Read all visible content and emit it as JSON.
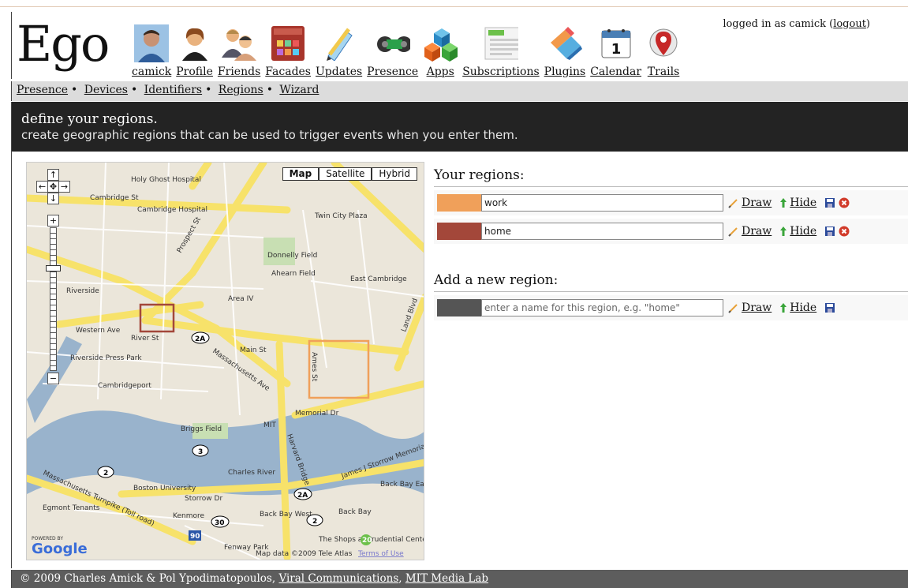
{
  "app": {
    "logo": "Ego"
  },
  "login": {
    "prefix": "logged in as camick (",
    "logout": "logout",
    "suffix": ")"
  },
  "nav": [
    {
      "label": "camick",
      "icon": "user-avatar-icon"
    },
    {
      "label": "Profile",
      "icon": "profile-icon"
    },
    {
      "label": "Friends",
      "icon": "friends-icon"
    },
    {
      "label": "Facades",
      "icon": "facades-icon"
    },
    {
      "label": "Updates",
      "icon": "pencil-icon"
    },
    {
      "label": "Presence",
      "icon": "presence-icon"
    },
    {
      "label": "Apps",
      "icon": "cubes-icon"
    },
    {
      "label": "Subscriptions",
      "icon": "subscriptions-icon"
    },
    {
      "label": "Plugins",
      "icon": "plugins-icon"
    },
    {
      "label": "Calendar",
      "icon": "calendar-icon"
    },
    {
      "label": "Trails",
      "icon": "map-pin-icon"
    }
  ],
  "calendar_day": "1",
  "subnav": [
    "Presence",
    "Devices",
    "Identifiers",
    "Regions",
    "Wizard"
  ],
  "subnav_sep": "•",
  "banner": {
    "title": "define your regions.",
    "subtitle": "create geographic regions that can be used to trigger events when you enter them."
  },
  "map": {
    "types": [
      "Map",
      "Satellite",
      "Hybrid"
    ],
    "selected_type": "Map",
    "powered_by": "POWERED BY",
    "google": "Google",
    "attribution": "Map data ©2009 Tele Atlas",
    "terms": "Terms of Use",
    "labels": [
      "Cambridge St",
      "Holy Ghost Hospital",
      "Cambridge Hospital",
      "Twin City Plaza",
      "Donnelly Field",
      "Ahearn Field",
      "East Cambridge",
      "Area IV",
      "Riverside",
      "Western Ave",
      "River St",
      "Main St",
      "Riverside Press Park",
      "Cambridgeport",
      "Memorial Dr",
      "MIT",
      "Briggs Field",
      "Charles River",
      "Boston University",
      "Storrow Dr",
      "Back Bay",
      "Kenmore",
      "Back Bay West",
      "Egmont Tenants",
      "Fenway Park",
      "Harvard Bridge",
      "James J Storrow Memorial",
      "Back Bay East",
      "The Shops at Prudential Center",
      "Massachusetts Ave",
      "Prospect St",
      "Massachusetts Turnpike (Toll road)",
      "Ames St",
      "Land Blvd"
    ],
    "shields": [
      "2A",
      "2A",
      "3",
      "2",
      "30",
      "2",
      "90",
      "20"
    ],
    "regions": [
      {
        "name": "home",
        "color": "#a3473a"
      },
      {
        "name": "work",
        "color": "#f0a05a"
      }
    ]
  },
  "your_regions": {
    "title": "Your regions:",
    "rows": [
      {
        "color": "#f0a05a",
        "value": "work"
      },
      {
        "color": "#a3473a",
        "value": "home"
      }
    ]
  },
  "new_region": {
    "title": "Add a new region:",
    "color": "#555555",
    "placeholder": "enter a name for this region, e.g. \"home\""
  },
  "actions": {
    "draw": "Draw",
    "hide": "Hide"
  },
  "footer": {
    "text": "© 2009 Charles Amick & Pol Ypodimatopoulos, ",
    "link1": "Viral Communications",
    "sep": ", ",
    "link2": "MIT Media Lab"
  }
}
